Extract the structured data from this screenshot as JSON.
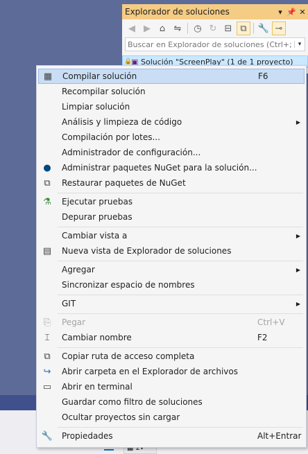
{
  "solution_explorer": {
    "title": "Explorador de soluciones",
    "title_buttons": [
      "▾",
      "ᵖ",
      "✕"
    ],
    "search_placeholder": "Buscar en Explorador de soluciones (Ctrl+;)",
    "root_item": "Solución \"ScreenPlay\" (1 de 1 proyecto)"
  },
  "menu": {
    "items": [
      {
        "label": "Compilar solución",
        "shortcut": "F6",
        "icon": "build-icon",
        "glyph": "▦",
        "color": "#1e1e1e"
      },
      {
        "label": "Recompilar solución",
        "shortcut": "",
        "icon": "",
        "glyph": ""
      },
      {
        "label": "Limpiar solución",
        "shortcut": "",
        "icon": "",
        "glyph": ""
      },
      {
        "label": "Análisis y limpieza de código",
        "shortcut": "",
        "submenu": true
      },
      {
        "label": "Compilación por lotes...",
        "shortcut": ""
      },
      {
        "label": "Administrador de configuración...",
        "shortcut": ""
      },
      {
        "label": "Administrar paquetes NuGet para la solución...",
        "shortcut": "",
        "icon": "nuget-icon",
        "glyph": "●"
      },
      {
        "label": "Restaurar paquetes de NuGet",
        "shortcut": "",
        "icon": "restore-packages-icon",
        "glyph": "⧉"
      },
      {
        "label": "Ejecutar pruebas",
        "shortcut": "",
        "icon": "run-tests-icon",
        "glyph": "⚗"
      },
      {
        "label": "Depurar pruebas",
        "shortcut": ""
      },
      {
        "label": "Cambiar vista a",
        "shortcut": "",
        "submenu": true
      },
      {
        "label": "Nueva vista de Explorador de soluciones",
        "shortcut": "",
        "icon": "new-view-icon",
        "glyph": "▤"
      },
      {
        "label": "Agregar",
        "shortcut": "",
        "submenu": true
      },
      {
        "label": "Sincronizar espacio de nombres",
        "shortcut": ""
      },
      {
        "label": "GIT",
        "shortcut": "",
        "submenu": true
      },
      {
        "label": "Pegar",
        "shortcut": "Ctrl+V",
        "icon": "paste-icon",
        "glyph": "📋",
        "disabled": true
      },
      {
        "label": "Cambiar nombre",
        "shortcut": "F2",
        "icon": "rename-icon",
        "glyph": "⌶"
      },
      {
        "label": "Copiar ruta de acceso completa",
        "shortcut": "",
        "icon": "copy-path-icon",
        "glyph": "⧉"
      },
      {
        "label": "Abrir carpeta en el Explorador de archivos",
        "shortcut": "",
        "icon": "open-folder-icon",
        "glyph": "↪"
      },
      {
        "label": "Abrir en terminal",
        "shortcut": "",
        "icon": "terminal-icon",
        "glyph": "▭"
      },
      {
        "label": "Guardar como filtro de soluciones",
        "shortcut": ""
      },
      {
        "label": "Ocultar proyectos sin cargar",
        "shortcut": ""
      },
      {
        "label": "Propiedades",
        "shortcut": "Alt+Entrar",
        "icon": "wrench-icon",
        "glyph": "🔧"
      }
    ]
  },
  "colors": {
    "accent": "#f5cc84",
    "highlight": "#c9def5",
    "selection": "#cce8ff",
    "background": "#5d6b99"
  }
}
